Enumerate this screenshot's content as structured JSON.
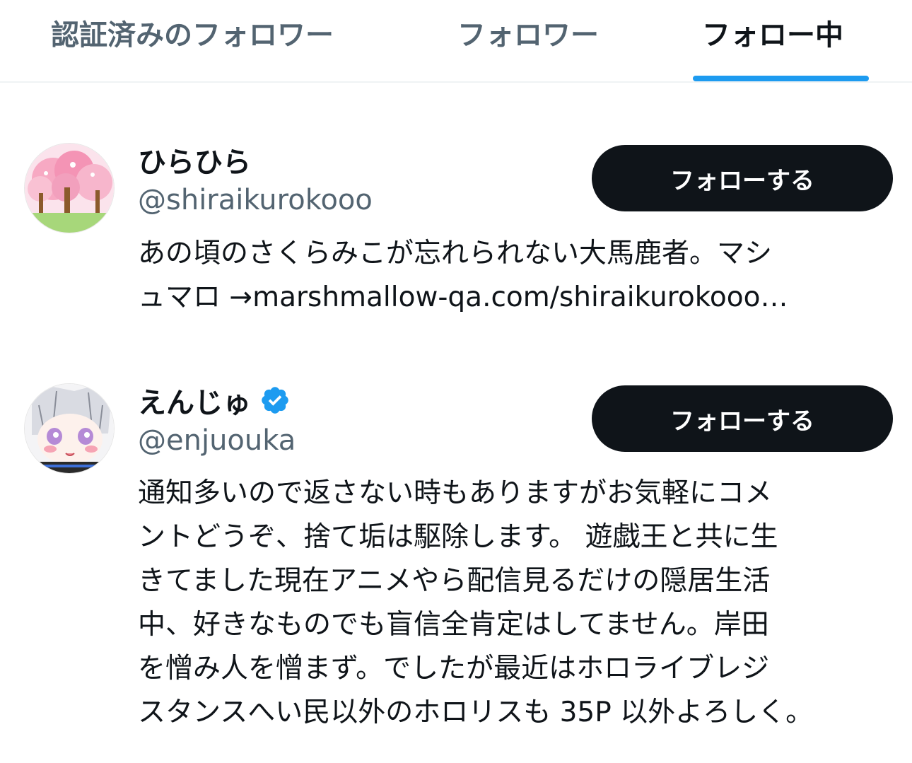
{
  "tabs": [
    {
      "label": "認証済みのフォロワー",
      "active": false
    },
    {
      "label": "フォロワー",
      "active": false
    },
    {
      "label": "フォロー中",
      "active": true
    }
  ],
  "colors": {
    "accent": "#1d9bf0",
    "text_primary": "#0f1419",
    "text_secondary": "#536471",
    "button_bg": "#0f1419",
    "verified": "#1d9bf0"
  },
  "users": [
    {
      "name": "ひらひら",
      "handle": "@shiraikurokooo",
      "verified": false,
      "follow_label": "フォローする",
      "bio_lines": [
        "あの頃のさくらみこが忘れられない大馬鹿者。マシ",
        "ュマロ →marshmallow-qa.com/shiraikurokooo…"
      ],
      "avatar_icon": "cherry-blossom-avatar"
    },
    {
      "name": "えんじゅ",
      "handle": "@enjuouka",
      "verified": true,
      "follow_label": "フォローする",
      "bio_lines": [
        "通知多いので返さない時もありますがお気軽にコメ",
        "ントどうぞ、捨て垢は駆除します。 遊戯王と共に生",
        "きてました現在アニメやら配信見るだけの隠居生活",
        "中、好きなものでも盲信全肯定はしてません。岸田",
        "を憎み人を憎まず。でしたが最近はホロライブレジ",
        "スタンスへい民以外のホロリスも 35P 以外よろしく。"
      ],
      "avatar_icon": "anime-girl-avatar"
    }
  ]
}
